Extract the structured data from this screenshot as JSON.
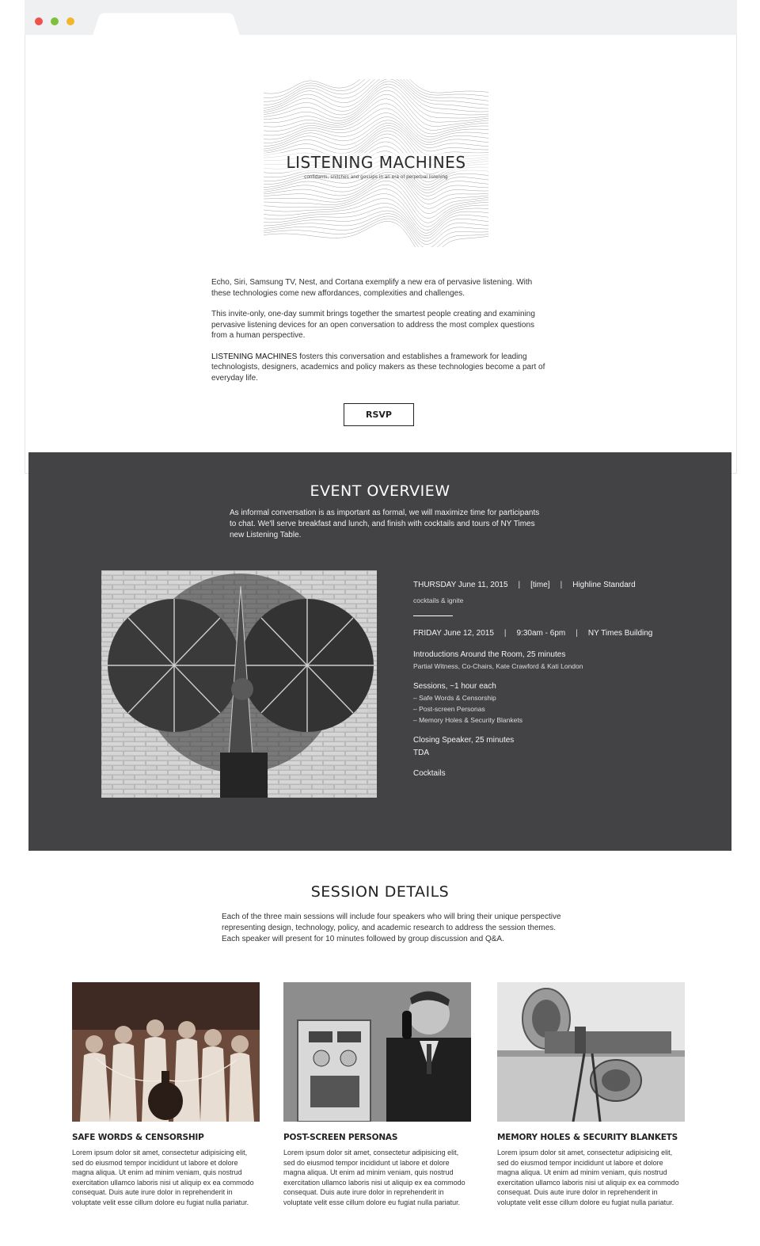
{
  "hero": {
    "title": "LISTENING MACHINES",
    "tagline": "confidants, snitches and gossips in an era of perpetual listening"
  },
  "intro": {
    "p1": "Echo, Siri, Samsung TV, Nest, and Cortana exemplify a new era of pervasive listening. With these technologies come new affordances, complexities and challenges.",
    "p2": "This invite-only, one-day summit brings together the smartest people creating and examining pervasive listening devices for an open conversation to address the most complex questions from a human perspective.",
    "p3_name": "LISTENING MACHINES",
    "p3_rest": " fosters this conversation and establishes a framework for leading technologists, designers, academics and policy makers as these technologies become a part of everyday life."
  },
  "rsvp_label": "RSVP",
  "overview": {
    "title": "EVENT OVERVIEW",
    "description": "As informal conversation is as important as formal, we will maximize time for participants to chat. We'll serve breakfast and lunch, and finish with cocktails and tours of NY Times new Listening Table.",
    "thursday": {
      "date": "THURSDAY June 11, 2015",
      "time": "[time]",
      "venue": "Highline Standard",
      "note": "cocktails & ignite"
    },
    "friday": {
      "date": "FRIDAY June 12, 2015",
      "time": "9:30am - 6pm",
      "venue": "NY Times Building"
    },
    "intro_title": "Introductions Around the Room, 25 minutes",
    "intro_people": "Partial Witness, Co-Chairs, Kate Crawford & Kati London",
    "sessions_title": "Sessions, ~1 hour each",
    "sessions": [
      "– Safe Words & Censorship",
      "– Post-screen Personas",
      "– Memory Holes & Security Blankets"
    ],
    "closing_title": "Closing Speaker, 25 minutes",
    "closing_name": "TDA",
    "cocktails": "Cocktails"
  },
  "details": {
    "title": "SESSION DETAILS",
    "description": "Each of the three main sessions will include four speakers who will bring their unique perspective representing design, technology, policy, and academic research to address the session themes. Each speaker will present for 10 minutes followed by group discussion and Q&A.",
    "cards": [
      {
        "title": "SAFE WORDS & CENSORSHIP",
        "body": "Lorem ipsum dolor sit amet, consectetur adipisicing elit, sed do eiusmod tempor incididunt ut labore et dolore magna aliqua. Ut enim ad minim veniam, quis nostrud exercitation ullamco laboris nisi ut aliquip ex ea commodo consequat. Duis aute irure dolor in reprehenderit in voluptate velit esse cillum dolore eu fugiat nulla pariatur."
      },
      {
        "title": "POST-SCREEN PERSONAS",
        "body": "Lorem ipsum dolor sit amet, consectetur adipisicing elit, sed do eiusmod tempor incididunt ut labore et dolore magna aliqua. Ut enim ad minim veniam, quis nostrud exercitation ullamco laboris nisi ut aliquip ex ea commodo consequat. Duis aute irure dolor in reprehenderit in voluptate velit esse cillum dolore eu fugiat nulla pariatur."
      },
      {
        "title": "MEMORY HOLES & SECURITY BLANKETS",
        "body": "Lorem ipsum dolor sit amet, consectetur adipisicing elit, sed do eiusmod tempor incididunt ut labore et dolore magna aliqua. Ut enim ad minim veniam, quis nostrud exercitation ullamco laboris nisi ut aliquip ex ea commodo consequat. Duis aute irure dolor in reprehenderit in voluptate velit esse cillum dolore eu fugiat nulla pariatur."
      }
    ]
  },
  "colors": {
    "overview_bg": "#434345",
    "chrome_bg": "#eef0f1",
    "dot_red": "#f0514f",
    "dot_green": "#7fbf3a",
    "dot_yellow": "#f3b62a"
  }
}
